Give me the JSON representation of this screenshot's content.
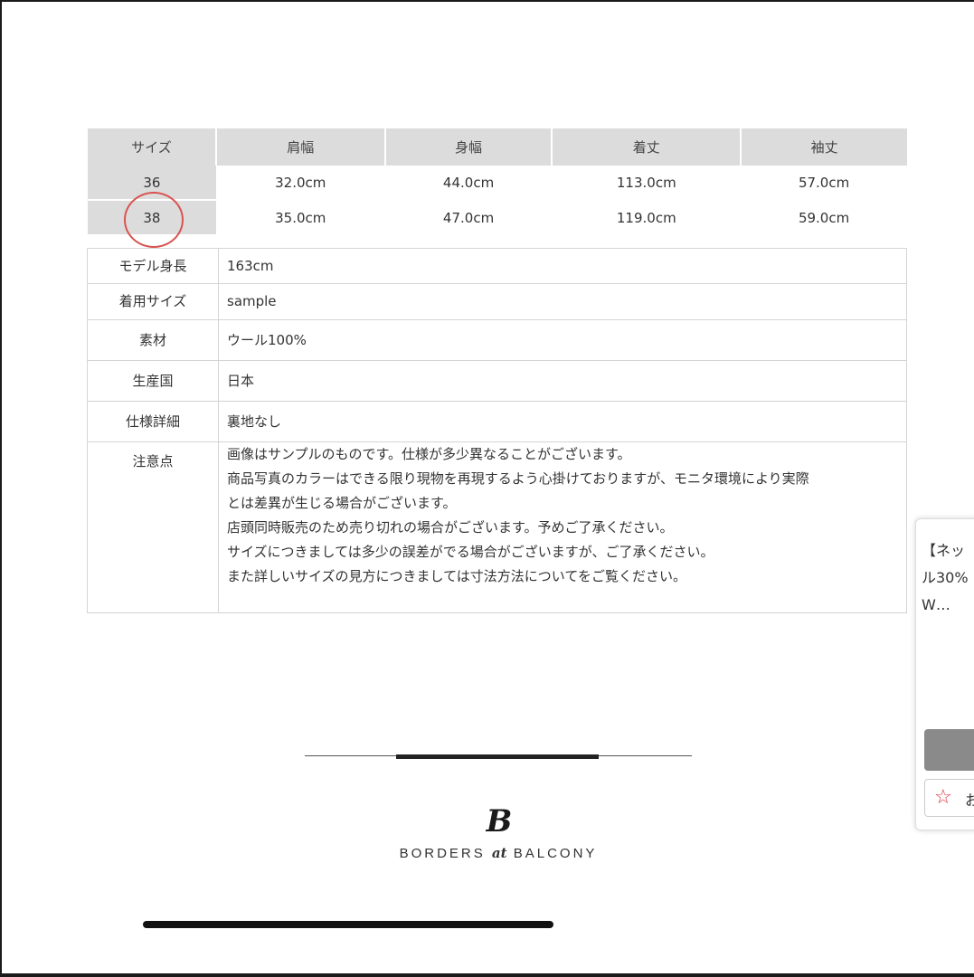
{
  "size_table": {
    "headers": [
      "サイズ",
      "肩幅",
      "身幅",
      "着丈",
      "袖丈"
    ],
    "rows": [
      [
        "36",
        "32.0cm",
        "44.0cm",
        "113.0cm",
        "57.0cm"
      ],
      [
        "38",
        "35.0cm",
        "47.0cm",
        "119.0cm",
        "59.0cm"
      ]
    ],
    "circled_size": "38"
  },
  "spec_table": {
    "rows": [
      {
        "label": "モデル身長",
        "value": "163cm"
      },
      {
        "label": "着用サイズ",
        "value": "sample"
      },
      {
        "label": "素材",
        "value": "ウール100%"
      },
      {
        "label": "生産国",
        "value": "日本"
      },
      {
        "label": "仕様詳細",
        "value": "裏地なし"
      }
    ],
    "notes_label": "注意点",
    "notes": [
      "画像はサンプルのものです。仕様が多少異なることがございます。",
      "商品写真のカラーはできる限り現物を再現するよう心掛けておりますが、モニタ環境により実際",
      "とは差異が生じる場合がございます。",
      "店頭同時販売のため売り切れの場合がございます。予めご了承ください。",
      "サイズにつきましては多少の誤差がでる場合がございますが、ご了承ください。",
      "また詳しいサイズの見方につきましては寸法方法についてをご覧ください。"
    ]
  },
  "brand": {
    "logo_mark": "B",
    "name_before": "BORDERS ",
    "name_at": "at",
    "name_after": " BALCONY"
  },
  "popup": {
    "lines": [
      "【ネッ",
      "ル30%",
      "W…"
    ],
    "fav_icon": "star-outline-icon",
    "fav_label": "お"
  },
  "colors": {
    "header_bg": "#dcdcdc",
    "circle": "#d9534f",
    "star": "#e0303a"
  }
}
